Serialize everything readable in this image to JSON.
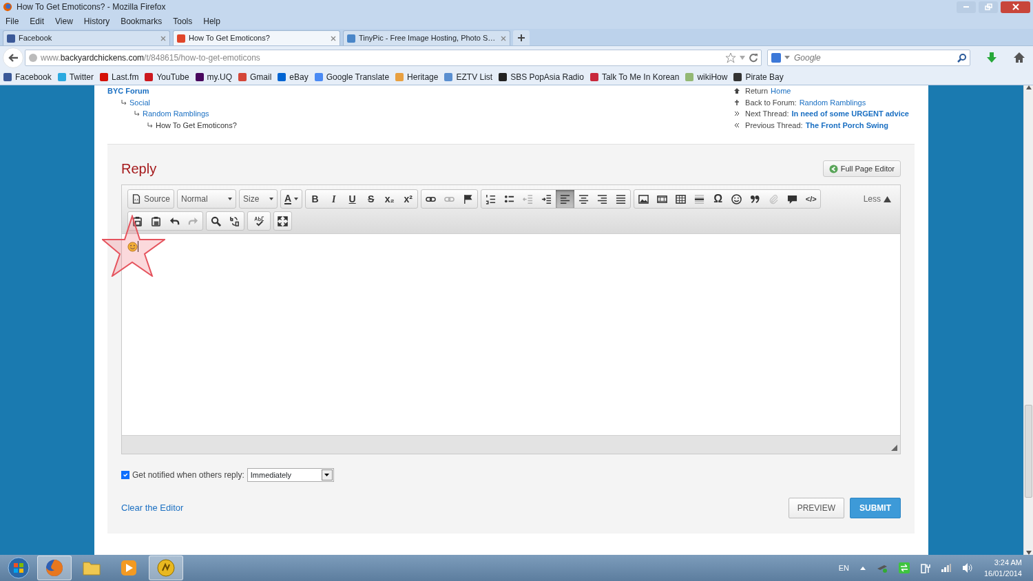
{
  "window": {
    "title": "How To Get Emoticons? - Mozilla Firefox"
  },
  "menu": [
    "File",
    "Edit",
    "View",
    "History",
    "Bookmarks",
    "Tools",
    "Help"
  ],
  "tabs": [
    {
      "label": "Facebook",
      "selected": false,
      "color": "#3b5998"
    },
    {
      "label": "How To Get Emoticons?",
      "selected": true,
      "color": "#e0462a"
    },
    {
      "label": "TinyPic - Free Image Hosting, Photo S…",
      "selected": false,
      "color": "#4a86c8"
    }
  ],
  "address": {
    "prefix": "www.",
    "host": "backyardchickens.com",
    "path": "/t/848615/how-to-get-emoticons"
  },
  "search": {
    "placeholder": "Google"
  },
  "bookmarks": [
    {
      "label": "Facebook",
      "color": "#3b5998"
    },
    {
      "label": "Twitter",
      "color": "#2aa9e0"
    },
    {
      "label": "Last.fm",
      "color": "#d51007"
    },
    {
      "label": "YouTube",
      "color": "#cc181e"
    },
    {
      "label": "my.UQ",
      "color": "#49075e"
    },
    {
      "label": "Gmail",
      "color": "#d44638"
    },
    {
      "label": "eBay",
      "color": "#0064d2"
    },
    {
      "label": "Google Translate",
      "color": "#4a8af4"
    },
    {
      "label": "Heritage",
      "color": "#e8a040"
    },
    {
      "label": "EZTV List",
      "color": "#5a8fd0"
    },
    {
      "label": "SBS PopAsia Radio",
      "color": "#222222"
    },
    {
      "label": "Talk To Me In Korean",
      "color": "#c8283c"
    },
    {
      "label": "wikiHow",
      "color": "#93b874"
    },
    {
      "label": "Pirate Bay",
      "color": "#333333"
    }
  ],
  "breadcrumb": {
    "label": "BYC Forum",
    "kind": "root",
    "children": [
      {
        "label": "Social",
        "kind": "link",
        "children": [
          {
            "label": "Random Ramblings",
            "kind": "link",
            "children": [
              {
                "label": "How To Get Emoticons?",
                "kind": "current"
              }
            ]
          }
        ]
      }
    ]
  },
  "thread_nav": [
    {
      "kind": "home",
      "label": "Return",
      "link": "Home"
    },
    {
      "kind": "up",
      "label": "Back to Forum:",
      "link": "Random Ramblings"
    },
    {
      "kind": "next",
      "label": "Next Thread:",
      "link": "In need of some URGENT advice"
    },
    {
      "kind": "previous",
      "label": "Previous Thread:",
      "link": "The Front Porch Swing"
    }
  ],
  "reply": {
    "title": "Reply",
    "full_page_button": "Full Page Editor",
    "toolbar": [
      [
        {
          "buttons": [
            {
              "kind": "source",
              "label": "Source",
              "selected": false,
              "disabled": false
            }
          ]
        },
        {
          "buttons": [
            {
              "kind": "dropdown",
              "label": "Normal",
              "selected": false,
              "disabled": false
            }
          ]
        },
        {
          "buttons": [
            {
              "kind": "dropdown",
              "label": "Size",
              "selected": false,
              "disabled": false
            }
          ]
        },
        {
          "buttons": [
            {
              "kind": "color",
              "label": "A",
              "selected": false,
              "disabled": false
            }
          ]
        },
        {
          "buttons": [
            {
              "kind": "bold",
              "label": "B",
              "selected": false,
              "disabled": false
            },
            {
              "kind": "italic",
              "label": "I",
              "selected": false,
              "disabled": false
            },
            {
              "kind": "underline",
              "label": "U",
              "selected": false,
              "disabled": false
            },
            {
              "kind": "strike",
              "label": "S",
              "selected": false,
              "disabled": false
            },
            {
              "kind": "sub",
              "label": "x₂",
              "selected": false,
              "disabled": false
            },
            {
              "kind": "sup",
              "label": "x²",
              "selected": false,
              "disabled": false
            }
          ]
        },
        {
          "buttons": [
            {
              "kind": "link",
              "selected": false,
              "disabled": false
            },
            {
              "kind": "link",
              "selected": false,
              "disabled": true
            },
            {
              "kind": "flag",
              "selected": false,
              "disabled": false
            }
          ]
        },
        {
          "buttons": [
            {
              "kind": "numlist",
              "selected": false,
              "disabled": false
            },
            {
              "kind": "bullist",
              "selected": false,
              "disabled": false
            },
            {
              "kind": "outdent",
              "selected": false,
              "disabled": true
            },
            {
              "kind": "indent",
              "selected": false,
              "disabled": false
            },
            {
              "kind": "alignleft",
              "selected": true,
              "disabled": false
            },
            {
              "kind": "aligncenter",
              "selected": false,
              "disabled": false
            },
            {
              "kind": "alignright",
              "selected": false,
              "disabled": false
            },
            {
              "kind": "justify",
              "selected": false,
              "disabled": false
            }
          ]
        },
        {
          "buttons": [
            {
              "kind": "image",
              "selected": false,
              "disabled": false
            },
            {
              "kind": "film",
              "selected": false,
              "disabled": false
            },
            {
              "kind": "table",
              "selected": false,
              "disabled": false
            },
            {
              "kind": "hr",
              "selected": false,
              "disabled": false
            },
            {
              "kind": "omega",
              "label": "Ω",
              "selected": false,
              "disabled": false
            },
            {
              "kind": "smiley",
              "selected": false,
              "disabled": false
            },
            {
              "kind": "quote",
              "selected": false,
              "disabled": false
            },
            {
              "kind": "clip",
              "selected": false,
              "disabled": true
            },
            {
              "kind": "comment",
              "selected": false,
              "disabled": false
            },
            {
              "kind": "code",
              "label": "</>",
              "selected": false,
              "disabled": false
            }
          ]
        }
      ],
      [
        {
          "buttons": [
            {
              "kind": "paste",
              "selected": false,
              "disabled": false
            },
            {
              "kind": "pasteword",
              "selected": false,
              "disabled": false
            },
            {
              "kind": "undo",
              "selected": false,
              "disabled": false
            },
            {
              "kind": "redo",
              "selected": false,
              "disabled": true
            }
          ]
        },
        {
          "buttons": [
            {
              "kind": "find",
              "selected": false,
              "disabled": false
            },
            {
              "kind": "replace",
              "selected": false,
              "disabled": false
            }
          ]
        },
        {
          "buttons": [
            {
              "kind": "spell",
              "selected": false,
              "disabled": false
            }
          ]
        },
        {
          "buttons": [
            {
              "kind": "maximize",
              "selected": false,
              "disabled": false
            }
          ]
        }
      ]
    ],
    "less": "Less",
    "content_emoticon": true,
    "notify": {
      "label": "Get notified when others reply:",
      "checked": true,
      "value": "Immediately"
    },
    "clear_link": "Clear the Editor",
    "buttons": [
      {
        "label": "PREVIEW",
        "kind": "secondary"
      },
      {
        "label": "SUBMIT",
        "kind": "primary"
      }
    ]
  },
  "taskbar": {
    "apps": [
      {
        "kind": "browser",
        "selected": true
      },
      {
        "kind": "folder",
        "selected": false
      },
      {
        "kind": "player",
        "selected": false
      },
      {
        "kind": "coin",
        "selected": true
      }
    ],
    "tray": {
      "language": "EN",
      "time": "3:24 AM",
      "date": "16/01/2014"
    }
  }
}
